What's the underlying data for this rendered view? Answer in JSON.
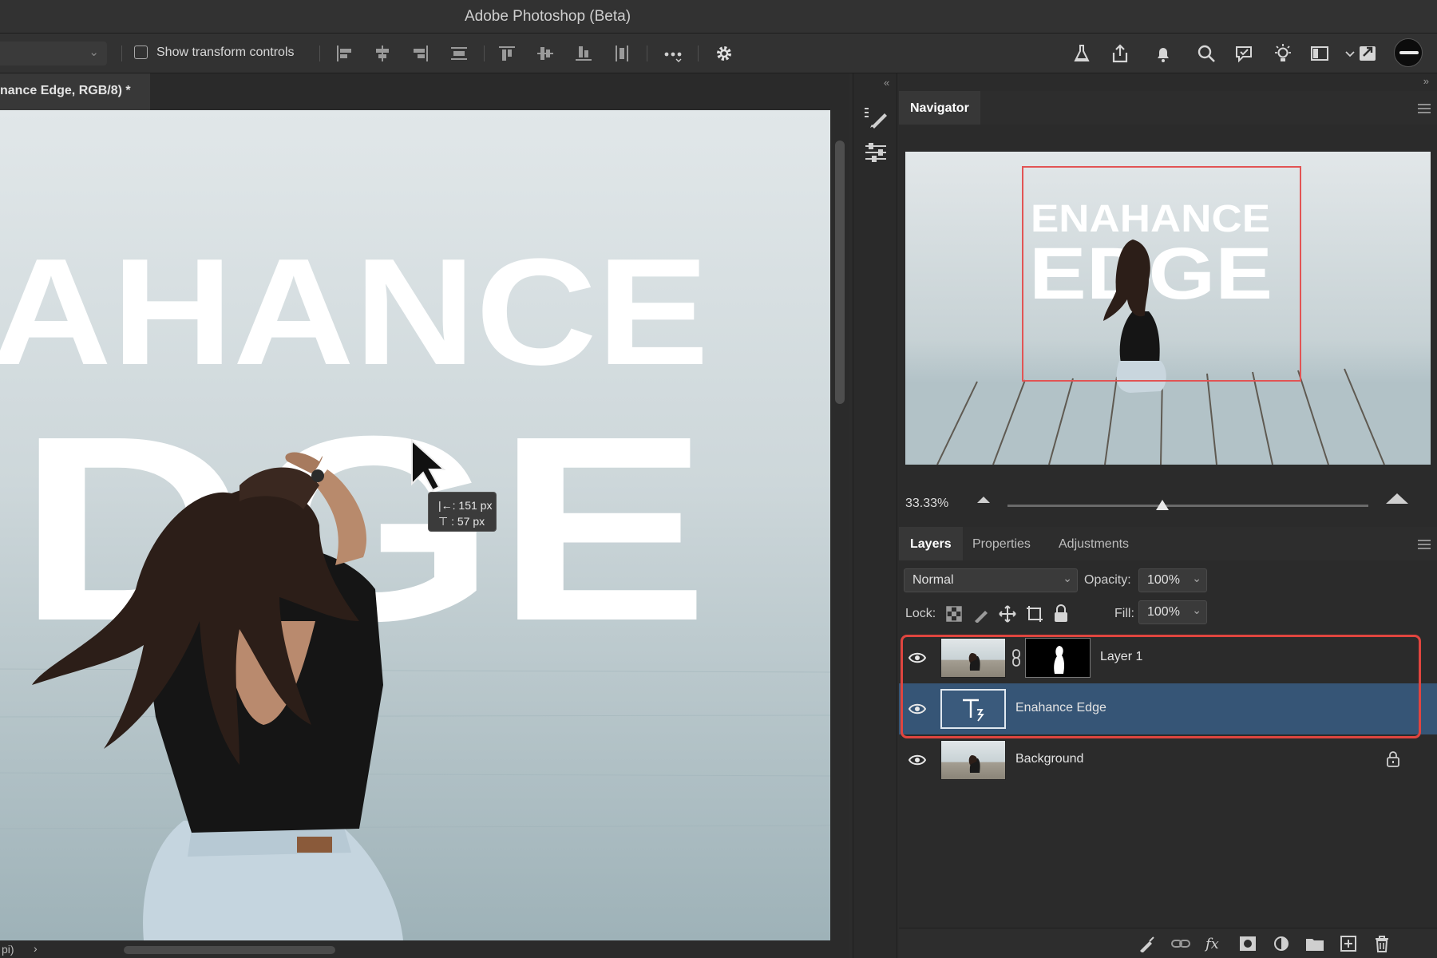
{
  "app": {
    "title": "Adobe Photoshop (Beta)"
  },
  "options_bar": {
    "show_transform_label": "Show transform controls",
    "show_transform_checked": false
  },
  "document": {
    "tab_label": "nance Edge, RGB/8) *",
    "status_text": "pi)",
    "status_arrow": "›"
  },
  "canvas": {
    "text_line1": "AHANCE",
    "text_line2": "DGE",
    "measure_h": "|←: 151 px",
    "measure_v": "⊤ :  57 px"
  },
  "navigator": {
    "tab": "Navigator",
    "text_line1": "ENAHANCE",
    "text_line2": "EDGE",
    "zoom": "33.33%",
    "zoom_slider_fraction": 0.43
  },
  "layers_panel": {
    "tabs": [
      "Layers",
      "Properties",
      "Adjustments"
    ],
    "active_tab": "Layers",
    "blend_mode": "Normal",
    "opacity_label": "Opacity:",
    "opacity_value": "100%",
    "lock_label": "Lock:",
    "fill_label": "Fill:",
    "fill_value": "100%",
    "layers": [
      {
        "name": "Layer 1",
        "selected": false,
        "has_mask": true
      },
      {
        "name": "Enahance Edge",
        "selected": true,
        "type": "text"
      },
      {
        "name": "Background",
        "selected": false,
        "locked": true
      }
    ]
  },
  "colors": {
    "highlight": "#e0453f",
    "selected_layer": "#365576",
    "navigator_frame": "#e25454"
  }
}
